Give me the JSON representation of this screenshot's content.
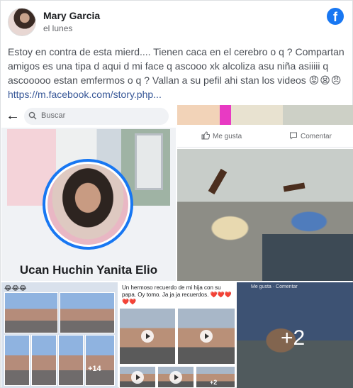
{
  "post": {
    "author": "Mary Garcia",
    "time": "el lunes",
    "text": "Estoy en contra de esta mierd.... Tienen caca en el cerebro o q ? Compartan amigos es una tipa d aqui d mi face q ascooo xk alcoliza asu niña asiiiii q ascooooo estan emfermos o q ? Vallan a su pefil ahi stan los videos",
    "emojis": "😡😫😠",
    "link": "https://m.facebook.com/story.php...",
    "brand_icon": "facebook-icon",
    "brand_color": "#1877f2"
  },
  "profile_shot": {
    "search_placeholder": "Buscar",
    "profile_name": "Ucan Huchin Yanita Elio"
  },
  "kids_shot": {
    "like_label": "Me gusta",
    "comment_label": "Comentar"
  },
  "collage_left": {
    "emojis": "😂😂😂",
    "more_label": "+14"
  },
  "collage_middle": {
    "caption": "Un hermoso  recuerdo de mi hija con su papa. Oy tomo. Ja ja ja recuerdos.",
    "hearts": "❤️❤️❤️❤️❤️",
    "more_label": "+2"
  },
  "collage_right": {
    "top_text": "Me gusta   ·   Comentar",
    "more_count": "+2"
  }
}
